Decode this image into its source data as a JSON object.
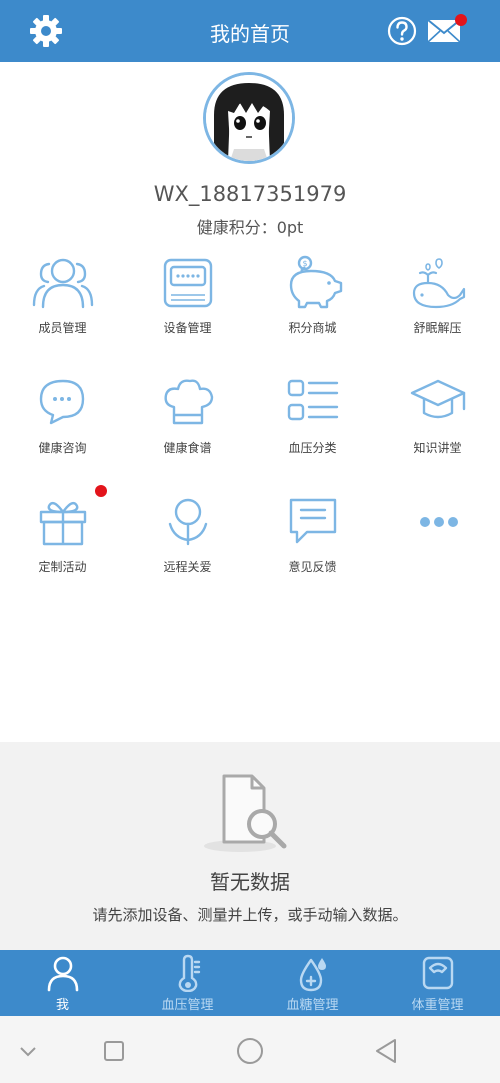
{
  "header": {
    "title": "我的首页",
    "settings_icon": "gear-icon",
    "help_icon": "question-circle-icon",
    "mail_icon": "envelope-icon"
  },
  "colors": {
    "primary": "#3d8acb",
    "icon_blue": "#7db6e4",
    "badge_red": "#e3141b",
    "empty_bg": "#f2f2f2"
  },
  "profile": {
    "username": "WX_18817351979",
    "points": "健康积分：0pt"
  },
  "grid": [
    {
      "label": "成员管理",
      "icon": "members-icon"
    },
    {
      "label": "设备管理",
      "icon": "device-icon"
    },
    {
      "label": "积分商城",
      "icon": "piggy-bank-icon"
    },
    {
      "label": "舒眠解压",
      "icon": "whale-icon"
    },
    {
      "label": "健康咨询",
      "icon": "chat-bubble-icon"
    },
    {
      "label": "健康食谱",
      "icon": "chef-hat-icon"
    },
    {
      "label": "血压分类",
      "icon": "list-icon"
    },
    {
      "label": "知识讲堂",
      "icon": "graduation-cap-icon"
    },
    {
      "label": "定制活动",
      "icon": "gift-icon",
      "badge": true
    },
    {
      "label": "远程关爱",
      "icon": "care-icon"
    },
    {
      "label": "意见反馈",
      "icon": "feedback-icon"
    },
    {
      "label": "",
      "icon": "more-dots-icon"
    }
  ],
  "empty_state": {
    "title": "暂无数据",
    "description": "请先添加设备、测量并上传，或手动输入数据。",
    "icon": "document-search-icon"
  },
  "tabs": [
    {
      "label": "我",
      "icon": "person-icon",
      "active": true
    },
    {
      "label": "血压管理",
      "icon": "thermometer-icon",
      "active": false
    },
    {
      "label": "血糖管理",
      "icon": "blood-drop-icon",
      "active": false
    },
    {
      "label": "体重管理",
      "icon": "scale-icon",
      "active": false
    }
  ],
  "system_nav": [
    "back-chevron-icon",
    "recent-apps-icon",
    "home-circle-icon",
    "back-triangle-icon"
  ]
}
